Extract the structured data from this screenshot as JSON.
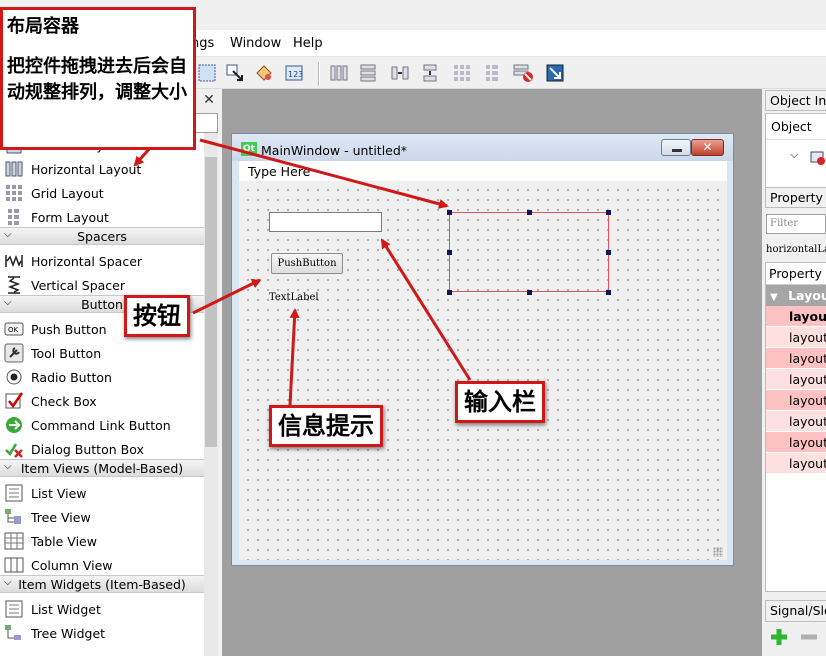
{
  "menubar": {
    "items": [
      "ngs",
      "Window",
      "Help"
    ]
  },
  "widget_box": {
    "close_label": "✕",
    "rows": [
      {
        "type": "item",
        "label": "Vertical Layout",
        "icon": "vertical-layout-icon"
      },
      {
        "type": "item",
        "label": "Horizontal Layout",
        "icon": "horizontal-layout-icon"
      },
      {
        "type": "item",
        "label": "Grid Layout",
        "icon": "grid-layout-icon"
      },
      {
        "type": "item",
        "label": "Form Layout",
        "icon": "form-layout-icon"
      },
      {
        "type": "category",
        "label": "Spacers"
      },
      {
        "type": "item",
        "label": "Horizontal Spacer",
        "icon": "horizontal-spacer-icon"
      },
      {
        "type": "item",
        "label": "Vertical Spacer",
        "icon": "vertical-spacer-icon"
      },
      {
        "type": "category",
        "label": "Button"
      },
      {
        "type": "item",
        "label": "Push Button",
        "icon": "push-button-icon"
      },
      {
        "type": "item",
        "label": "Tool Button",
        "icon": "tool-button-icon"
      },
      {
        "type": "item",
        "label": "Radio Button",
        "icon": "radio-button-icon"
      },
      {
        "type": "item",
        "label": "Check Box",
        "icon": "check-box-icon"
      },
      {
        "type": "item",
        "label": "Command Link Button",
        "icon": "command-link-icon"
      },
      {
        "type": "item",
        "label": "Dialog Button Box",
        "icon": "dialog-button-box-icon"
      },
      {
        "type": "category",
        "label": "Item Views (Model-Based)"
      },
      {
        "type": "item",
        "label": "List View",
        "icon": "list-view-icon"
      },
      {
        "type": "item",
        "label": "Tree View",
        "icon": "tree-view-icon"
      },
      {
        "type": "item",
        "label": "Table View",
        "icon": "table-view-icon"
      },
      {
        "type": "item",
        "label": "Column View",
        "icon": "column-view-icon"
      },
      {
        "type": "category",
        "label": "Item Widgets (Item-Based)"
      },
      {
        "type": "item",
        "label": "List Widget",
        "icon": "list-widget-icon"
      },
      {
        "type": "item",
        "label": "Tree Widget",
        "icon": "tree-widget-icon"
      }
    ]
  },
  "main_window": {
    "logo": "Qt",
    "title": "MainWindow - untitled*",
    "close_label": "✕",
    "menu_placeholder": "Type Here",
    "push_button_label": "PushButton",
    "text_label": "TextLabel"
  },
  "right_panels": {
    "object_inspector_title": "Object Inspector",
    "object_column": "Object",
    "property_editor_title": "Property Editor",
    "filter_placeholder": "Filter",
    "object_name": "horizontalLayoutWidget",
    "property_column": "Property",
    "group_label": "Layout",
    "rows": [
      "layoutName",
      "layoutLeftMargin",
      "layoutTopMargin",
      "layoutRightMargin",
      "layoutBottomMargin",
      "layoutSpacing",
      "layoutStretch",
      "layoutSizeConstraint"
    ],
    "row_colors": [
      "#ffc2c2",
      "#ffe0e0",
      "#ffc2c2",
      "#ffe0e0",
      "#ffc2c2",
      "#ffe0e0",
      "#ffc2c2",
      "#ffe0e0"
    ],
    "signal_slot_title": "Signal/Slot Editor"
  },
  "annotations": {
    "layout_container_title": "布局容器",
    "layout_container_desc": "把控件拖拽进去后会自动规整排列，调整大小",
    "button_label": "按钮",
    "info_label": "信息提示",
    "input_label": "输入栏"
  },
  "colors": {
    "annotation_red": "#d01818",
    "layout_outline": "#e05060",
    "qt_green": "#41cd52",
    "property_group": "#a6a6a6"
  }
}
